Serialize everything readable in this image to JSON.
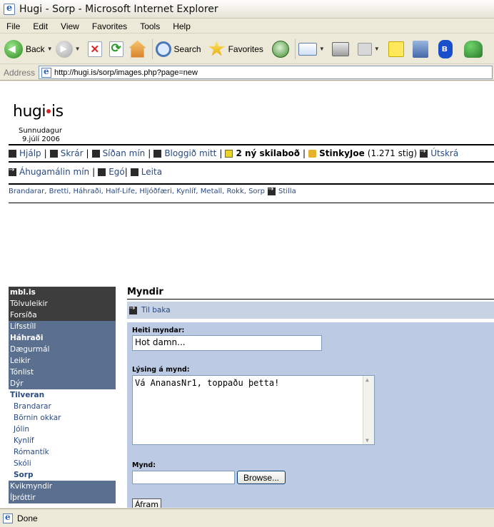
{
  "window": {
    "title": "Hugi - Sorp - Microsoft Internet Explorer"
  },
  "menu": [
    "File",
    "Edit",
    "View",
    "Favorites",
    "Tools",
    "Help"
  ],
  "toolbar": {
    "back": "Back",
    "search": "Search",
    "favorites": "Favorites"
  },
  "address": {
    "label": "Address",
    "url": "http://hugi.is/sorp/images.php?page=new"
  },
  "site": {
    "logo_left": "hugi",
    "logo_right": "is",
    "day": "Sunnudagur",
    "date": "9.júlí 2006"
  },
  "nav1": {
    "help": "Hjálp",
    "files": "Skrár",
    "mypage": "Síðan mín",
    "blog": "Bloggið mitt",
    "messages": "2 ný skilaboð",
    "user": "StinkyJoe",
    "points": "(1.271 stig)",
    "logout": "Útskrá"
  },
  "nav2": {
    "interests": "Áhugamálin mín",
    "ego": "Egó",
    "search": "Leita"
  },
  "cats": {
    "list": "Brandarar, Bretti, Háhraði, Half-Life, Hljóðfæri, Kynlíf, Metall, Rokk, Sorp",
    "settings": "Stilla"
  },
  "sidebar": {
    "dark": [
      "mbl.is",
      "Tölvuleikir",
      "Forsíða"
    ],
    "blue": [
      "Lífsstíll",
      "Háhraði",
      "Dægurmál",
      "Leikir",
      "Tónlist",
      "Dýr"
    ],
    "head": "Tilveran",
    "plain": [
      "Brandarar",
      "Börnin okkar",
      "Jólin",
      "Kynlíf",
      "Rómantík",
      "Skóli",
      "Sorp"
    ],
    "blue2": [
      "Kvikmyndir",
      "Íþróttir"
    ]
  },
  "main": {
    "title": "Myndir",
    "back": "Til baka",
    "name_label": "Heiti myndar:",
    "name_value": "Hot damn...",
    "desc_label": "Lýsing á mynd:",
    "desc_value": "Vá AnanasNr1, toppaðu þetta!",
    "image_label": "Mynd:",
    "browse": "Browse...",
    "submit": "Áfram"
  },
  "status": {
    "text": "Done"
  }
}
